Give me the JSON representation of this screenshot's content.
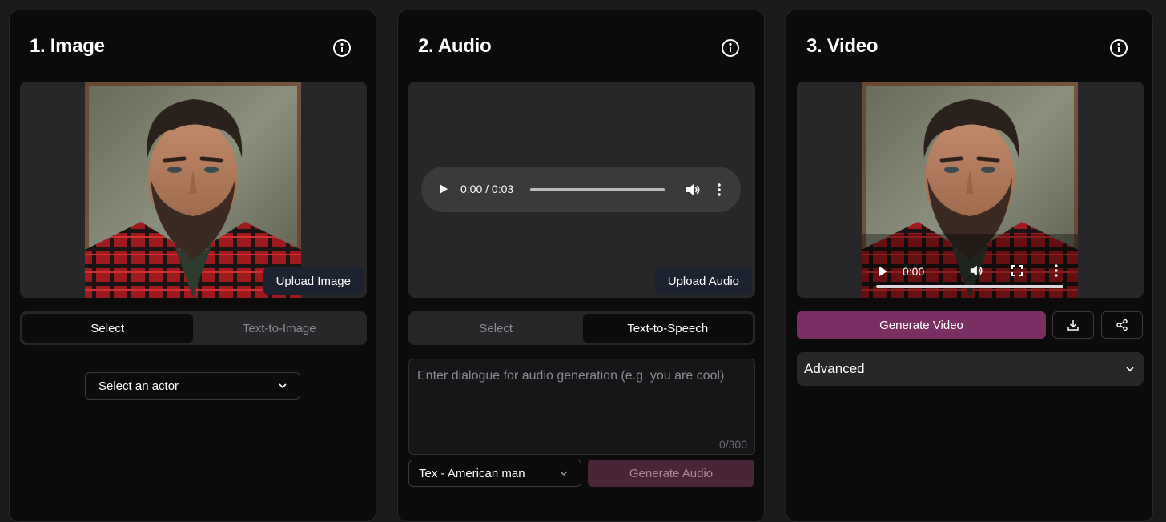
{
  "image_panel": {
    "title": "1. Image",
    "upload_label": "Upload Image",
    "tabs": [
      {
        "label": "Select",
        "active": true
      },
      {
        "label": "Text-to-Image",
        "active": false
      }
    ],
    "actor_select": {
      "value": "Select an actor"
    }
  },
  "audio_panel": {
    "title": "2. Audio",
    "player": {
      "time": "0:00 / 0:03"
    },
    "upload_label": "Upload Audio",
    "tabs": [
      {
        "label": "Select",
        "active": false
      },
      {
        "label": "Text-to-Speech",
        "active": true
      }
    ],
    "dialogue": {
      "placeholder": "Enter dialogue for audio generation (e.g. you are cool)",
      "value": "",
      "char_count": "0/300"
    },
    "voice_select": {
      "value": "Tex - American man"
    },
    "generate_label": "Generate Audio"
  },
  "video_panel": {
    "title": "3. Video",
    "player": {
      "time": "0:00"
    },
    "generate_label": "Generate Video",
    "advanced_label": "Advanced"
  },
  "icons": {
    "info": "info-circle-icon",
    "play": "play-icon",
    "volume": "volume-icon",
    "more": "more-vertical-icon",
    "fullscreen": "fullscreen-icon",
    "download": "download-icon",
    "share": "share-icon",
    "chevron": "chevron-down-icon"
  },
  "colors": {
    "background": "#1a1a1c",
    "panel": "#0b0b0c",
    "accent": "#7a2f63",
    "accent_disabled": "#4a2538"
  }
}
